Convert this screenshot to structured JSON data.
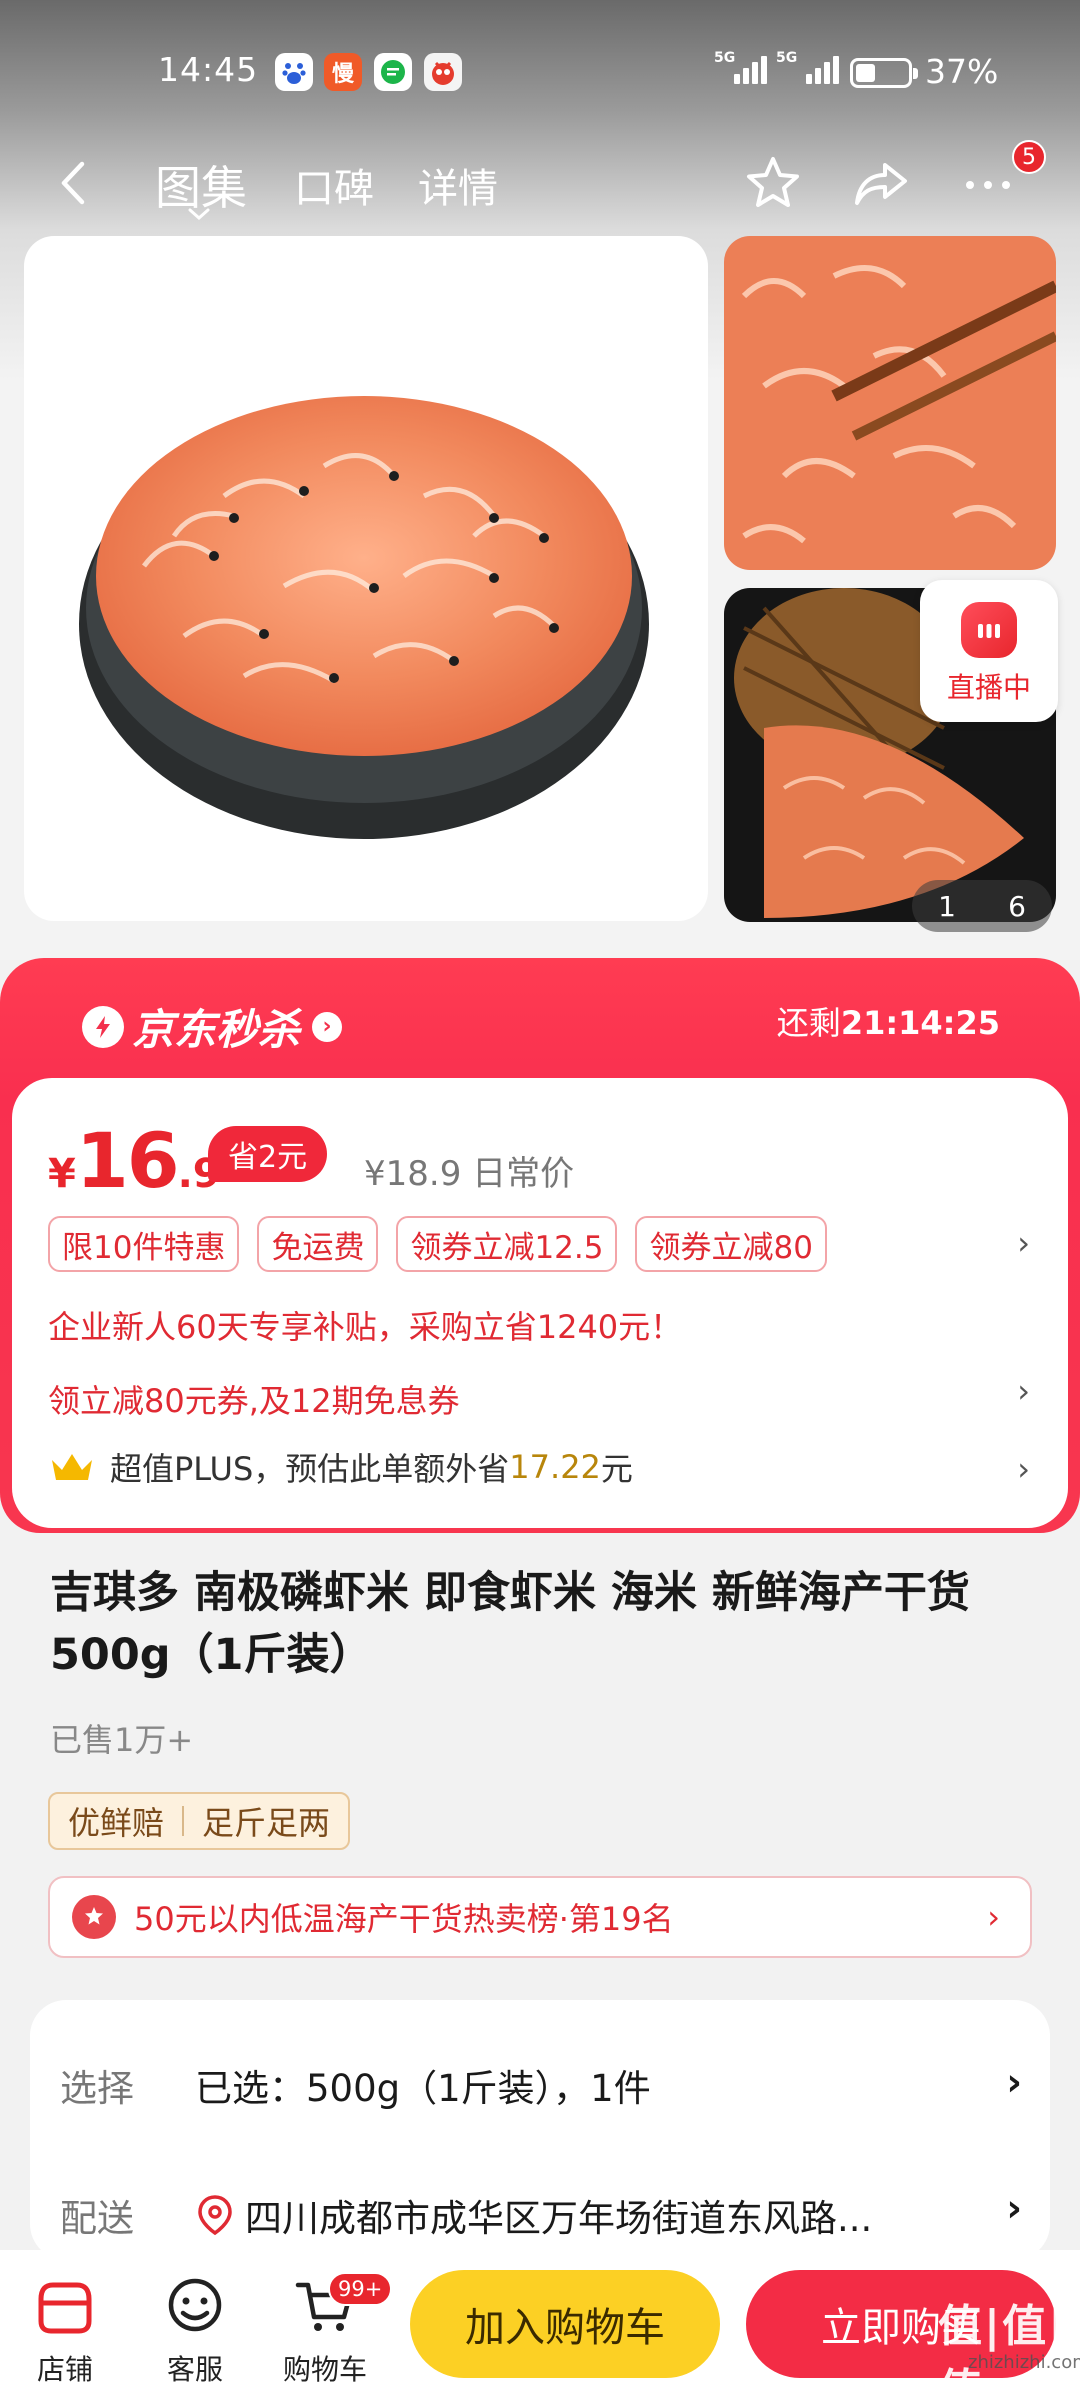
{
  "status_bar": {
    "time": "14:45",
    "app_icons": [
      "baidu-icon",
      "manman-icon",
      "chat-icon",
      "game-icon"
    ],
    "signal_1": "5G",
    "signal_2": "5G",
    "battery_level": 0.37,
    "battery": "37%"
  },
  "nav": {
    "tabs": [
      {
        "label": "图集",
        "active": true
      },
      {
        "label": "口碑",
        "active": false
      },
      {
        "label": "详情",
        "active": false
      }
    ],
    "message_badge": "5"
  },
  "gallery": {
    "live_label": "直播中",
    "page_current": "1",
    "page_total": "6"
  },
  "flash_sale": {
    "title": "京东秒杀",
    "remaining_label": "还剩",
    "remaining_time": "21:14:25"
  },
  "price": {
    "currency": "¥",
    "integer": "16",
    "decimal": ".9",
    "save_tag": "省2元",
    "original_price": "¥18.9 日常价"
  },
  "promos": [
    "限10件特惠",
    "免运费",
    "领券立减12.5",
    "领券立减80"
  ],
  "enterprise_line": "企业新人60天专享补贴，采购立省1240元！",
  "coupon_line": "领立减80元券,及12期免息券",
  "plus": {
    "label": "超值PLUS",
    "text": "，预估此单额外省",
    "amount": "17.22",
    "unit": "元"
  },
  "product": {
    "title": "吉琪多 南极磷虾米 即食虾米 海米 新鲜海产干货 500g（1斤装）",
    "sold": "已售1万+",
    "service_tags": [
      "优鲜赔",
      "足斤足两"
    ],
    "rank": "50元以内低温海产干货热卖榜·第19名"
  },
  "selection": {
    "select_label": "选择",
    "select_value": "已选：500g（1斤装），1件",
    "delivery_label": "配送",
    "delivery_value": "四川成都市成华区万年场街道东风路..."
  },
  "bottom_bar": {
    "shop": "店铺",
    "service": "客服",
    "cart": "购物车",
    "cart_badge": "99+",
    "add_to_cart": "加入购物车",
    "buy_now": "立即购买"
  },
  "watermark": {
    "main": "值|值|值",
    "sub": "zhizhizhi.com"
  },
  "colors": {
    "accent_red": "#f32c45",
    "cart_yellow": "#fcd024",
    "price_red": "#e8262d"
  }
}
